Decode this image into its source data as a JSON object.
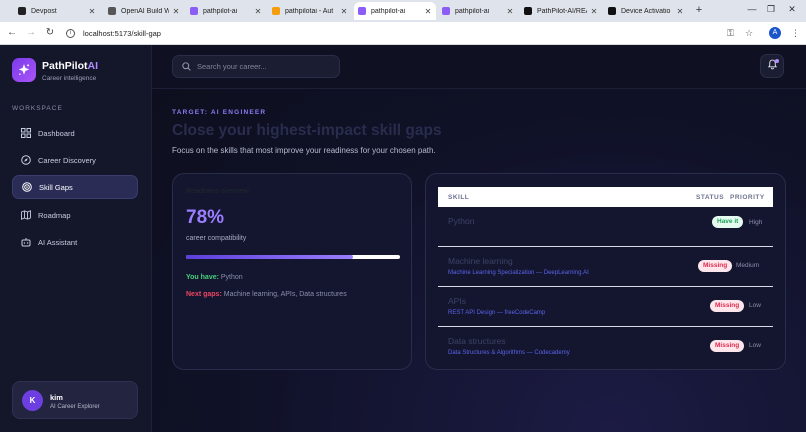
{
  "browser": {
    "tabs": [
      {
        "label": "Devpost",
        "icon": "devpost-icon",
        "color": "#222222",
        "active": false
      },
      {
        "label": "OpenAI Build W",
        "icon": "openai-icon",
        "color": "#555555",
        "active": false
      },
      {
        "label": "pathpilot-ai",
        "icon": "vite-icon",
        "color": "#8b5cf6",
        "active": false
      },
      {
        "label": "pathpilotai - Aut",
        "icon": "firebase-icon",
        "color": "#f59e0b",
        "active": false
      },
      {
        "label": "pathpilot-ai",
        "icon": "vite-icon",
        "color": "#8b5cf6",
        "active": true
      },
      {
        "label": "pathpilot-ai",
        "icon": "vite-icon",
        "color": "#8b5cf6",
        "active": false
      },
      {
        "label": "PathPilot-AI/REA",
        "icon": "github-icon",
        "color": "#111111",
        "active": false
      },
      {
        "label": "Device Activatio",
        "icon": "github-icon",
        "color": "#111111",
        "active": false
      }
    ],
    "url": "localhost:5173/skill-gap",
    "profile_initial": "A"
  },
  "brand": {
    "name": "PathPilot",
    "name_accent": "AI",
    "tagline": "Career intelligence"
  },
  "sidebar": {
    "section": "WORKSPACE",
    "items": [
      {
        "label": "Dashboard",
        "icon": "dashboard-icon",
        "active": false
      },
      {
        "label": "Career Discovery",
        "icon": "compass-icon",
        "active": false
      },
      {
        "label": "Skill Gaps",
        "icon": "target-icon",
        "active": true
      },
      {
        "label": "Roadmap",
        "icon": "map-icon",
        "active": false
      },
      {
        "label": "AI Assistant",
        "icon": "robot-icon",
        "active": false
      }
    ],
    "user": {
      "initial": "K",
      "name": "kim",
      "role": "AI Career Explorer"
    }
  },
  "topbar": {
    "search_placeholder": "Search your career..."
  },
  "page": {
    "eyebrow": "TARGET: AI ENGINEER",
    "title": "Close your highest-impact skill gaps",
    "subtitle": "Focus on the skills that most improve your readiness for your chosen path."
  },
  "readiness": {
    "label": "Readiness overview",
    "percent_text": "78%",
    "percent_value": 78,
    "caption": "career compatibility",
    "have_label": "You have:",
    "have_value": "Python",
    "next_label": "Next gaps:",
    "next_value": "Machine learning, APIs, Data structures"
  },
  "skills_table": {
    "headers": {
      "skill": "SKILL",
      "status": "STATUS",
      "priority": "PRIORITY"
    },
    "rows": [
      {
        "skill": "Python",
        "resource": "",
        "status": "Have it",
        "status_type": "have",
        "priority": "High"
      },
      {
        "skill": "Machine learning",
        "resource": "Machine Learning Specialization — DeepLearning.AI",
        "status": "Missing",
        "status_type": "missing",
        "priority": "Medium"
      },
      {
        "skill": "APIs",
        "resource": "REST API Design — freeCodeCamp",
        "status": "Missing",
        "status_type": "missing",
        "priority": "Low"
      },
      {
        "skill": "Data structures",
        "resource": "Data Structures & Algorithms — Codecademy",
        "status": "Missing",
        "status_type": "missing",
        "priority": "Low"
      }
    ]
  }
}
